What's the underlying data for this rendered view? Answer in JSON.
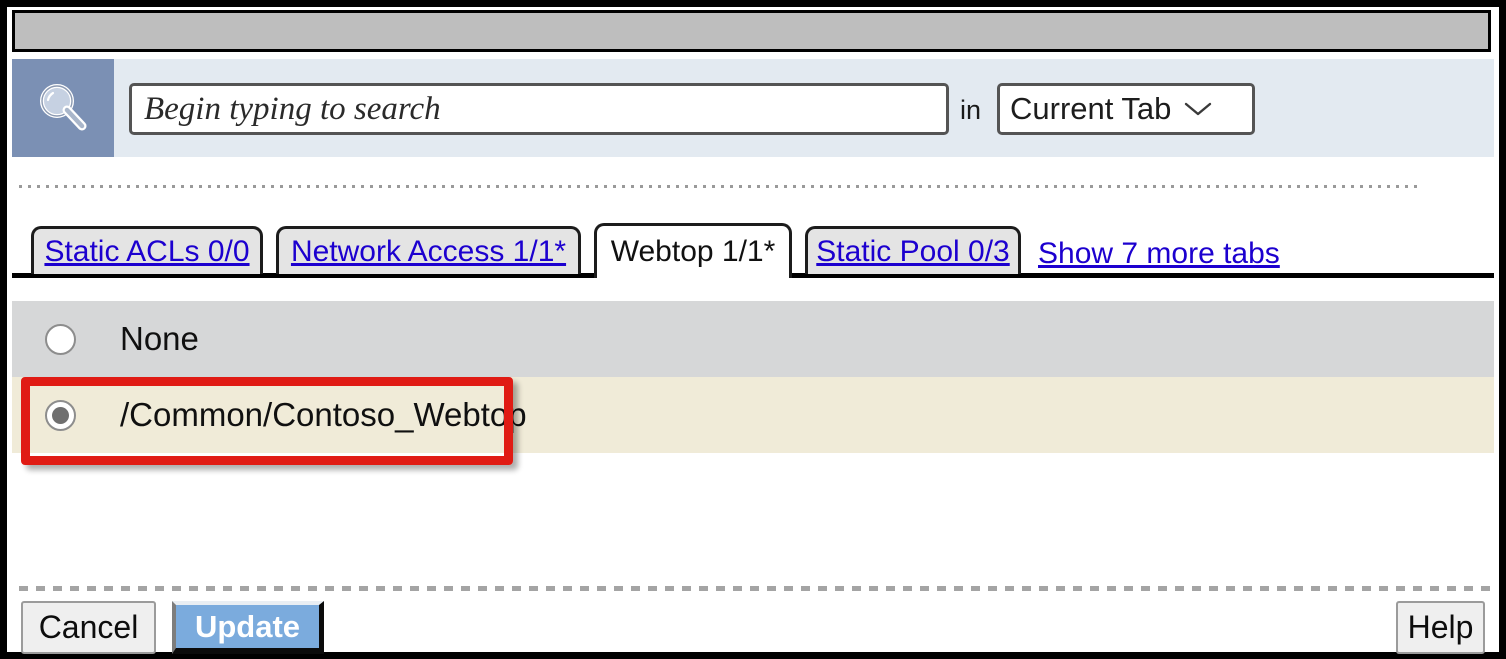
{
  "window": {
    "titlebar_text": ""
  },
  "search": {
    "icon": "search-icon",
    "placeholder": "Begin typing to search",
    "value": "",
    "in_label": "in",
    "scope_value": "Current Tab",
    "scope_chevron_icon": "chevron-down-icon"
  },
  "tabs": {
    "items": [
      {
        "label": "Static ACLs 0/0",
        "active": false
      },
      {
        "label": "Network Access 1/1*",
        "active": false
      },
      {
        "label": "Webtop 1/1*",
        "active": true
      },
      {
        "label": "Static Pool 0/3",
        "active": false
      }
    ],
    "more_link": "Show 7 more tabs"
  },
  "options": {
    "items": [
      {
        "label": "None",
        "selected": false
      },
      {
        "label": "/Common/Contoso_Webtop",
        "selected": true
      }
    ]
  },
  "annotation": {
    "color": "#e01b14",
    "target": "/Common/Contoso_Webtop"
  },
  "footer": {
    "cancel_label": "Cancel",
    "update_label": "Update",
    "help_label": "Help"
  },
  "colors": {
    "titlebar": "#bebebe",
    "search_strip": "#e3eaf1",
    "search_icon_bg": "#7b90b4",
    "row_unselected": "#d6d7d8",
    "row_selected": "#f0ebd8",
    "tab_link": "#1c00cf",
    "update_button": "#7babdd",
    "annotation": "#e01b14"
  }
}
